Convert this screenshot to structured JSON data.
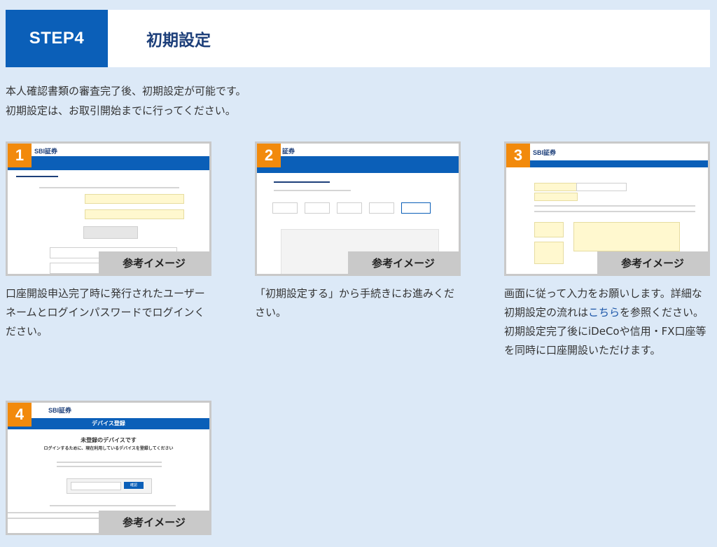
{
  "header": {
    "step": "STEP4",
    "title": "初期設定"
  },
  "intro": {
    "line1": "本人確認書類の審査完了後、初期設定が可能です。",
    "line2": "初期設定は、お取引開始までに行ってください。"
  },
  "cards": [
    {
      "number": "1",
      "ref_label": "参考イメージ",
      "desc": "口座開設申込完了時に発行されたユーザーネームとログインパスワードでログインください。",
      "screen": {
        "logo": "SBI証券"
      }
    },
    {
      "number": "2",
      "ref_label": "参考イメージ",
      "desc": "「初期設定する」から手続きにお進みください。",
      "screen": {
        "logo": "証券"
      }
    },
    {
      "number": "3",
      "ref_label": "参考イメージ",
      "desc_before": "画面に従って入力をお願いします。詳細な初期設定の流れは",
      "link": "こちら",
      "desc_after": "を参照ください。初期設定完了後にiDeCoや信用・FX口座等を同時に口座開設いただけます。",
      "screen": {
        "logo": "SBI証券"
      }
    },
    {
      "number": "4",
      "ref_label": "参考イメージ",
      "screen": {
        "logo": "SBI証券",
        "bar_title": "デバイス登録",
        "heading1": "未登録のデバイスです",
        "heading2": "ログインするために、現在利用しているデバイスを登録してください",
        "button": "確認"
      }
    }
  ],
  "colors": {
    "accent": "#0b5fb8",
    "badge": "#f28a0c",
    "background": "#dce9f7"
  }
}
